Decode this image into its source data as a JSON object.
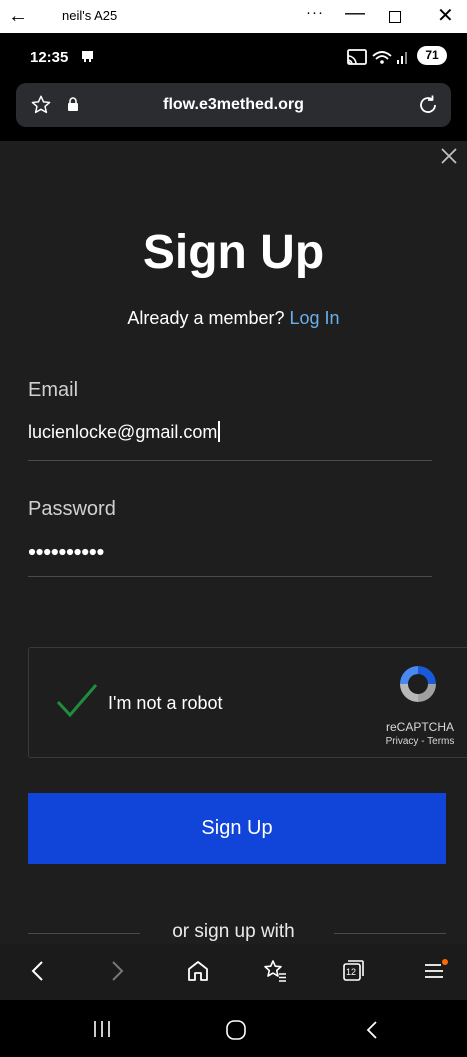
{
  "window": {
    "title": "neil's A25",
    "back_glyph": "←",
    "more_glyph": "···",
    "minimize_glyph": "—",
    "close_glyph": "✕"
  },
  "status_bar": {
    "time": "12:35",
    "battery": "71"
  },
  "browser": {
    "url": "flow.e3methed.org"
  },
  "signup": {
    "title": "Sign Up",
    "member_prompt": "Already a member?",
    "login_link": "Log In",
    "email_label": "Email",
    "email_value": "lucienlocke@gmail.com",
    "password_label": "Password",
    "password_dot_count": 10,
    "captcha_label": "I'm not a robot",
    "captcha_brand": "reCAPTCHA",
    "captcha_links": "Privacy - Terms",
    "submit_label": "Sign Up",
    "alt_signup": "or sign up with"
  },
  "toolbar": {
    "tab_count": "12"
  },
  "colors": {
    "page_bg": "#1e1e1e",
    "button_blue": "#1144d9",
    "link_blue": "#6aaeea",
    "check_green": "#1e8e3e",
    "notification_dot": "#ff6a00"
  },
  "icons": [
    "back-arrow-icon",
    "more-icon",
    "minimize-icon",
    "maximize-icon",
    "close-icon",
    "notification-icon",
    "cast-icon",
    "wifi-icon",
    "signal-icon",
    "star-icon",
    "lock-icon",
    "reload-icon",
    "close-x-icon",
    "checkmark-icon",
    "recaptcha-logo-icon",
    "back-icon",
    "forward-icon",
    "home-icon",
    "bookmarks-icon",
    "tabs-icon",
    "menu-icon",
    "recents-icon",
    "nav-home-icon",
    "nav-back-icon"
  ]
}
